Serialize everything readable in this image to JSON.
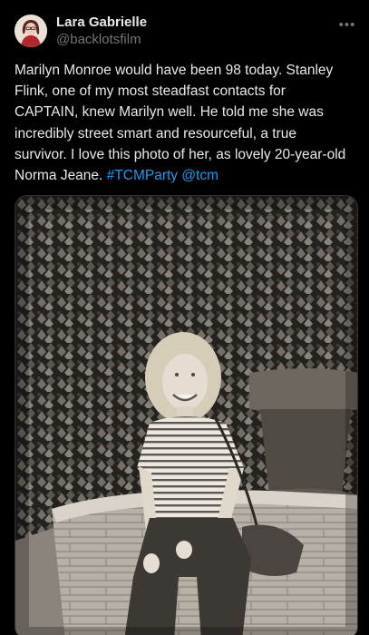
{
  "post": {
    "author": {
      "display_name": "Lara Gabrielle",
      "handle": "@backlotsfilm"
    },
    "more_icon": "more-horizontal-icon",
    "text": "Marilyn Monroe would have been 98 today. Stanley Flink, one of my most steadfast contacts for CAPTAIN, knew Marilyn well. He told me she was incredibly street smart and resourceful, a true survivor. I love this photo of her, as lovely 20-year-old Norma Jeane.",
    "hashtag": "#TCMParty",
    "mention": "@tcm",
    "image": {
      "description_icon": "photo",
      "alt": "Black and white photo of a young woman in a striped shirt sitting on the edge of a stone fountain in front of ivy"
    }
  },
  "colors": {
    "background": "#000000",
    "text": "#e7e9ea",
    "secondary": "#71767b",
    "link": "#1d9bf0"
  }
}
